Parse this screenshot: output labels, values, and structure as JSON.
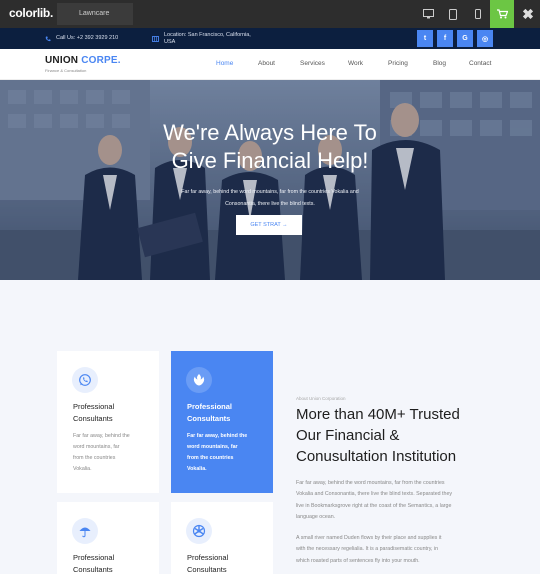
{
  "preview_bar": {
    "logo": "colorlib",
    "theme": "Lawncare",
    "icons": [
      "desktop-icon",
      "tablet-icon",
      "mobile-icon",
      "cart-icon",
      "close-icon"
    ],
    "close_glyph": "✖"
  },
  "topbar": {
    "phone": "Call Us: +2 392 3929 210",
    "location_line1": "Location: San Francisco, California,",
    "location_line2": "USA",
    "social": [
      "twitter-icon",
      "facebook-icon",
      "google-icon",
      "instagram-icon"
    ],
    "social_glyphs": [
      "t",
      "f",
      "G",
      "◎"
    ]
  },
  "brand": {
    "name_dark": "UNION",
    "name_accent": "CORPE.",
    "tagline": "Finance & Consultation"
  },
  "nav": [
    "Home",
    "About",
    "Services",
    "Work",
    "Pricing",
    "Blog",
    "Contact"
  ],
  "hero": {
    "title_line1": "We're Always Here To",
    "title_line2": "Give Financial Help!",
    "subtitle_line1": "Far far away, behind the word mountains, far from the countries Vokalia and",
    "subtitle_line2": "Consonantia, there live the blind texts.",
    "cta": "GET STRAT →"
  },
  "services": [
    {
      "title_line1": "Professional",
      "title_line2": "Consultants",
      "text": [
        "Far far away, behind the",
        "word mountains, far",
        "from the countries",
        "Vokalia."
      ],
      "icon": "whatsapp-icon"
    },
    {
      "title_line1": "Professional",
      "title_line2": "Consultants",
      "text": [
        "Far far away, behind the",
        "word mountains, far",
        "from the countries",
        "Vokalia."
      ],
      "icon": "rebel-icon"
    },
    {
      "title_line1": "Professional",
      "title_line2": "Consultants",
      "icon": "umbrella-icon"
    },
    {
      "title_line1": "Professional",
      "title_line2": "Consultants",
      "icon": "empire-icon"
    }
  ],
  "about": {
    "kicker": "About Union Corporation",
    "title_line1": "More than 40M+ Trusted",
    "title_line2": "Our Financial &",
    "title_line3": "Conusultation Institution",
    "p1": [
      "Far far away, behind the word mountains, far from the countries",
      "Vokalia and Consonantia, there live the blind texts. Separated they",
      "live in Bookmarksgrove right at the coast of the Semantics, a large",
      "language ocean."
    ],
    "p2": [
      "A small river named Duden flows by their place and supplies it",
      "with the necessary regelialia. It is a paradisematic country, in",
      "which roasted parts of sentences fly into your mouth."
    ]
  },
  "colors": {
    "accent": "#4a86f2",
    "topbar": "#0c1f3f",
    "preview_bar": "#2d2d2d",
    "cart": "#6cc644"
  }
}
